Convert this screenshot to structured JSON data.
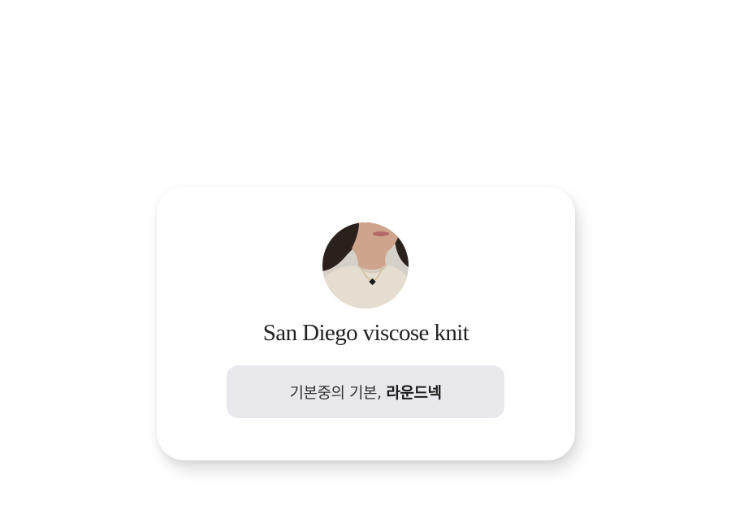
{
  "card": {
    "product_name": "San Diego viscose knit",
    "tagline_regular": "기본중의 기본,",
    "tagline_bold": "라운드넥"
  },
  "colors": {
    "card_background": "#ffffff",
    "tagline_background": "#e9e8ec",
    "title_text": "#222222"
  }
}
